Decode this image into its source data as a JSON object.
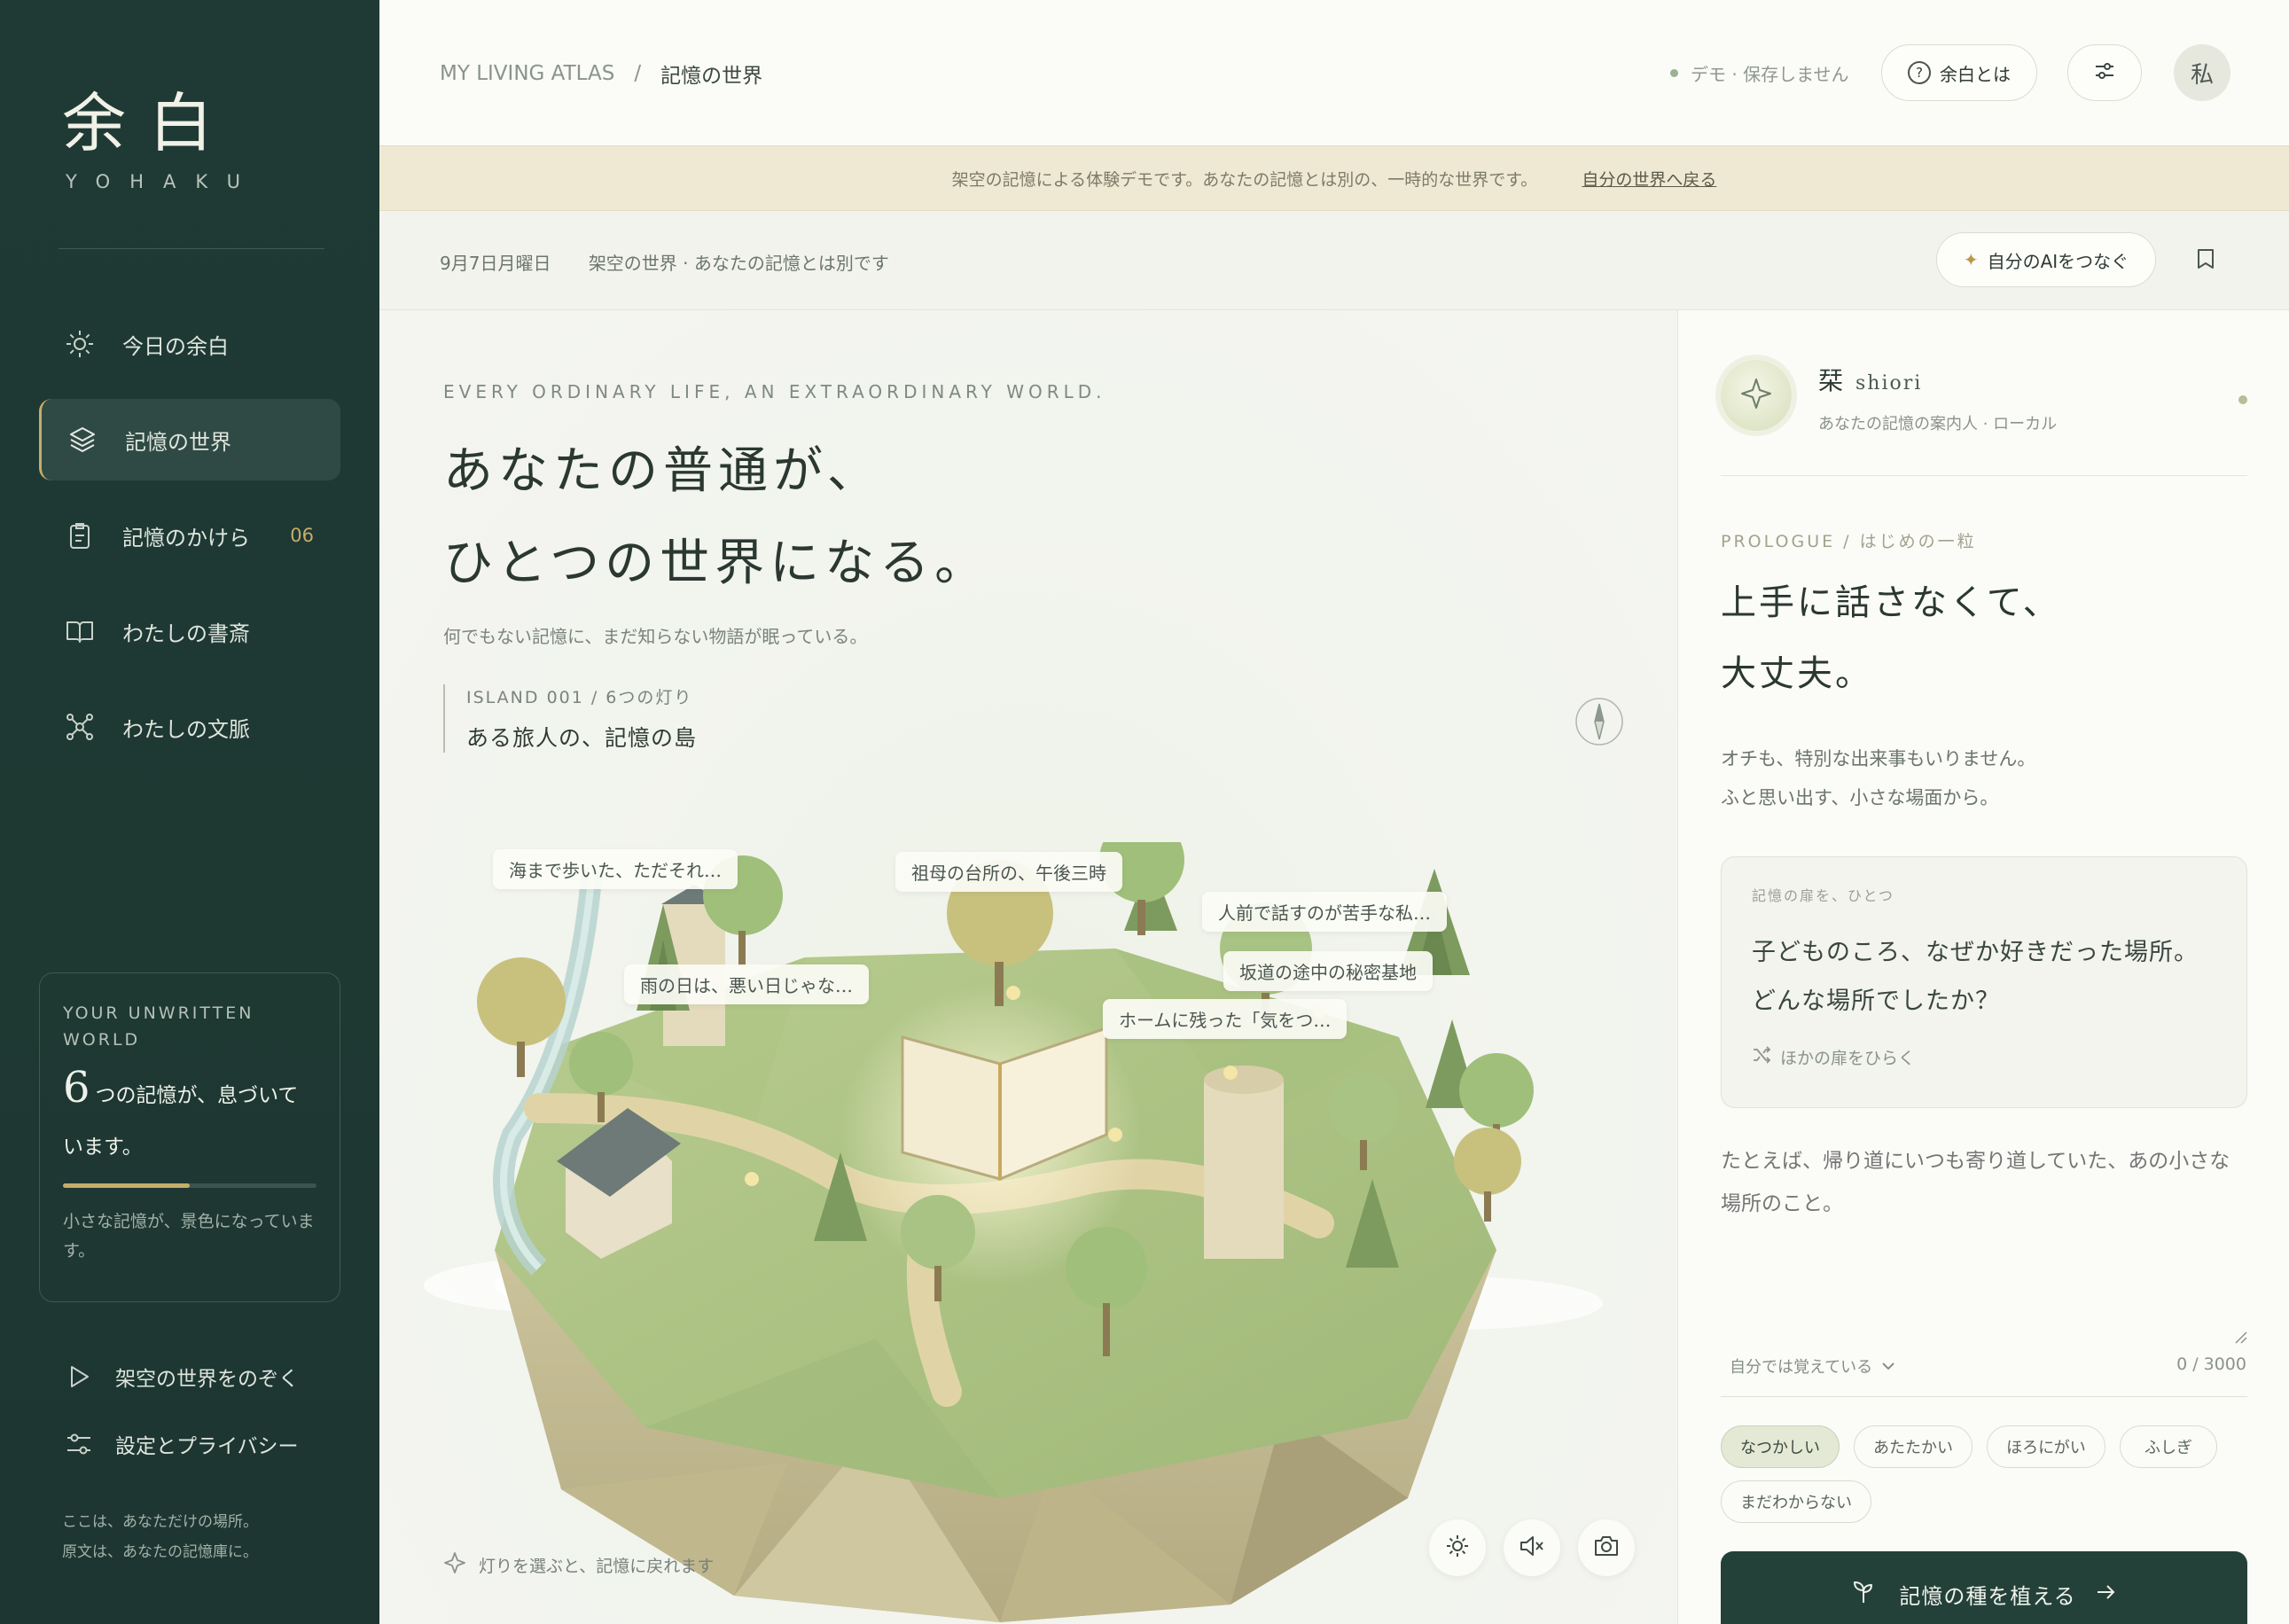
{
  "brand": {
    "name_jp": "余白",
    "name_en": "YOHAKU"
  },
  "sidebar": {
    "items": [
      {
        "label": "今日の余白",
        "icon": "sun-icon"
      },
      {
        "label": "記憶の世界",
        "icon": "layers-icon",
        "active": true
      },
      {
        "label": "記憶のかけら",
        "icon": "clipboard-icon",
        "badge": "06"
      },
      {
        "label": "わたしの書斎",
        "icon": "book-icon"
      },
      {
        "label": "わたしの文脈",
        "icon": "network-icon"
      }
    ],
    "world_card": {
      "title": "YOUR UNWRITTEN WORLD",
      "count": "6",
      "count_text": "つの記憶が、息づいています。",
      "progress": 0.5,
      "note": "小さな記憶が、景色になっています。"
    },
    "links": [
      {
        "label": "架空の世界をのぞく",
        "icon": "play-icon"
      },
      {
        "label": "設定とプライバシー",
        "icon": "sliders-icon"
      }
    ],
    "footer_line1": "ここは、あなただけの場所。",
    "footer_line2": "原文は、あなたの記憶庫に。"
  },
  "topbar": {
    "breadcrumb_root": "MY LIVING ATLAS",
    "breadcrumb_sep": "/",
    "breadcrumb_current": "記憶の世界",
    "demo_status": "デモ · 保存しません",
    "about_label": "余白とは",
    "avatar_label": "私"
  },
  "banner": {
    "text": "架空の記憶による体験デモです。あなたの記憶とは別の、一時的な世界です。",
    "link": "自分の世界へ戻る"
  },
  "subheader": {
    "date": "9月7日月曜日",
    "world_note": "架空の世界 · あなたの記憶とは別です",
    "connect_ai": "自分のAIをつなぐ"
  },
  "stage": {
    "eyebrow": "EVERY ORDINARY LIFE, AN EXTRAORDINARY WORLD.",
    "title_line1": "あなたの普通が、",
    "title_line2": "ひとつの世界になる。",
    "subtitle": "何でもない記憶に、まだ知らない物語が眠っている。",
    "island_code": "ISLAND 001 / 6つの灯り",
    "island_name": "ある旅人の、記憶の島",
    "map_labels": [
      "海まで歩いた、ただそれ…",
      "祖母の台所の、午後三時",
      "人前で話すのが苦手な私…",
      "雨の日は、悪い日じゃな…",
      "坂道の途中の秘密基地",
      "ホームに残った「気をつ…"
    ],
    "hint": "灯りを選ぶと、記憶に戻れます"
  },
  "panel": {
    "guide_name": "栞",
    "guide_latin": "shiori",
    "guide_role": "あなたの記憶の案内人 · ローカル",
    "prologue": "PROLOGUE / はじめの一粒",
    "heading_line1": "上手に話さなくて、",
    "heading_line2": "大丈夫。",
    "desc_line1": "オチも、特別な出来事もいりません。",
    "desc_line2": "ふと思い出す、小さな場面から。",
    "door_label": "記憶の扉を、ひとつ",
    "door_q1": "子どものころ、なぜか好きだった場所。",
    "door_q2": "どんな場所でしたか？",
    "door_other": "ほかの扉をひらく",
    "textarea_placeholder": "たとえば、帰り道にいつも寄り道していた、あの小さな場所のこと。",
    "recall_select": "自分では覚えている",
    "char_count": "0 / 3000",
    "chips": [
      "なつかしい",
      "あたたかい",
      "ほろにがい",
      "ふしぎ",
      "まだわからない"
    ],
    "selected_chip": "なつかしい",
    "plant_button": "記憶の種を植える"
  },
  "colors": {
    "sidebar_bg": "#1f3a34",
    "accent_gold": "#c5ad6c",
    "primary_button": "#244139",
    "banner_bg": "#efe9d4"
  }
}
